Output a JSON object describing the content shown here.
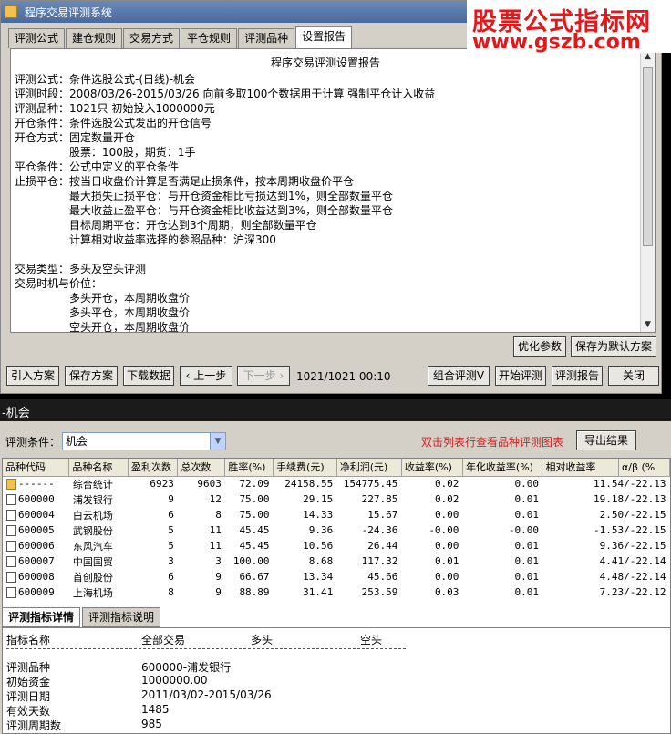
{
  "window": {
    "title": "程序交易评测系统",
    "close": "×"
  },
  "watermark": {
    "line1": "股票公式指标网",
    "line2": "www.gszb.com"
  },
  "tabs": [
    "评测公式",
    "建仓规则",
    "交易方式",
    "平仓规则",
    "评测品种",
    "设置报告"
  ],
  "report": {
    "title": "程序交易评测设置报告",
    "lines": [
      "评测公式：条件选股公式-(日线)-机会",
      "评测时段：2008/03/26-2015/03/26 向前多取100个数据用于计算 强制平仓计入收益",
      "评测品种：1021只 初始投入1000000元",
      "开仓条件：条件选股公式发出的开仓信号",
      "开仓方式：固定数量开仓",
      "　　　　　股票：100股，期货：1手",
      "平仓条件：公式中定义的平仓条件",
      "止损平仓：按当日收盘价计算是否满足止损条件，按本周期收盘价平仓",
      "　　　　　最大损失止损平仓：与开仓资金相比亏损达到1%，则全部数量平仓",
      "　　　　　最大收益止盈平仓：与开仓资金相比收益达到3%，则全部数量平仓",
      "　　　　　目标周期平仓：开仓达到3个周期，则全部数量平仓",
      "　　　　　计算相对收益率选择的参照品种：沪深300",
      "",
      "交易类型：多头及空头评测",
      "交易时机与价位：",
      "　　　　　多头开仓，本周期收盘价",
      "　　　　　多头平仓，本周期收盘价",
      "　　　　　空头开仓，本周期收盘价"
    ]
  },
  "buttons": {
    "optimize": "优化参数",
    "save_default": "保存为默认方案",
    "import": "引入方案",
    "save": "保存方案",
    "download": "下载数据",
    "prev": "上一步",
    "next": "下一步",
    "counter": "1021/1021  00:10",
    "combine": "组合评测V",
    "start": "开始评测",
    "report": "评测报告",
    "close": "关闭",
    "export": "导出结果"
  },
  "results": {
    "title": "-机会",
    "condition_label": "评测条件：",
    "condition_value": "机会",
    "hint": "双击列表行查看品种评测图表",
    "columns": [
      "品种代码",
      "品种名称",
      "盈利次数",
      "总次数",
      "胜率(%)",
      "手续费(元)",
      "净利润(元)",
      "收益率(%)",
      "年化收益率(%)",
      "相对收益率",
      "α/β (%"
    ],
    "rows": [
      [
        "------",
        "综合统计",
        "6923",
        "9603",
        "72.09",
        "24158.55",
        "154775.45",
        "0.02",
        "0.00",
        "11.54/-22.13"
      ],
      [
        "600000",
        "浦发银行",
        "9",
        "12",
        "75.00",
        "29.15",
        "227.85",
        "0.02",
        "0.01",
        "19.18/-22.13"
      ],
      [
        "600004",
        "白云机场",
        "6",
        "8",
        "75.00",
        "14.33",
        "15.67",
        "0.00",
        "0.01",
        "2.50/-22.15"
      ],
      [
        "600005",
        "武钢股份",
        "5",
        "11",
        "45.45",
        "9.36",
        "-24.36",
        "-0.00",
        "-0.00",
        "-1.53/-22.15"
      ],
      [
        "600006",
        "东风汽车",
        "5",
        "11",
        "45.45",
        "10.56",
        "26.44",
        "0.00",
        "0.01",
        "9.36/-22.15"
      ],
      [
        "600007",
        "中国国贸",
        "3",
        "3",
        "100.00",
        "8.68",
        "117.32",
        "0.01",
        "0.01",
        "4.41/-22.14"
      ],
      [
        "600008",
        "首创股份",
        "6",
        "9",
        "66.67",
        "13.34",
        "45.66",
        "0.00",
        "0.01",
        "4.48/-22.14"
      ],
      [
        "600009",
        "上海机场",
        "8",
        "9",
        "88.89",
        "31.41",
        "253.59",
        "0.03",
        "0.01",
        "7.23/-22.12"
      ]
    ]
  },
  "detail_tabs": [
    "评测指标详情",
    "评测指标说明"
  ],
  "detail": {
    "headers": [
      "指标名称",
      "全部交易",
      "多头",
      "空头"
    ],
    "rows": [
      [
        "评测品种",
        "600000-浦发银行"
      ],
      [
        "初始资金",
        "1000000.00"
      ],
      [
        "评测日期",
        "2011/03/02-2015/03/26"
      ],
      [
        "有效天数",
        "1485"
      ],
      [
        "评测周期数",
        "985"
      ]
    ]
  },
  "colors": {
    "accent_red": "#e4171b",
    "hint_red": "#d02020",
    "titlebar": "#4a6a9c"
  }
}
